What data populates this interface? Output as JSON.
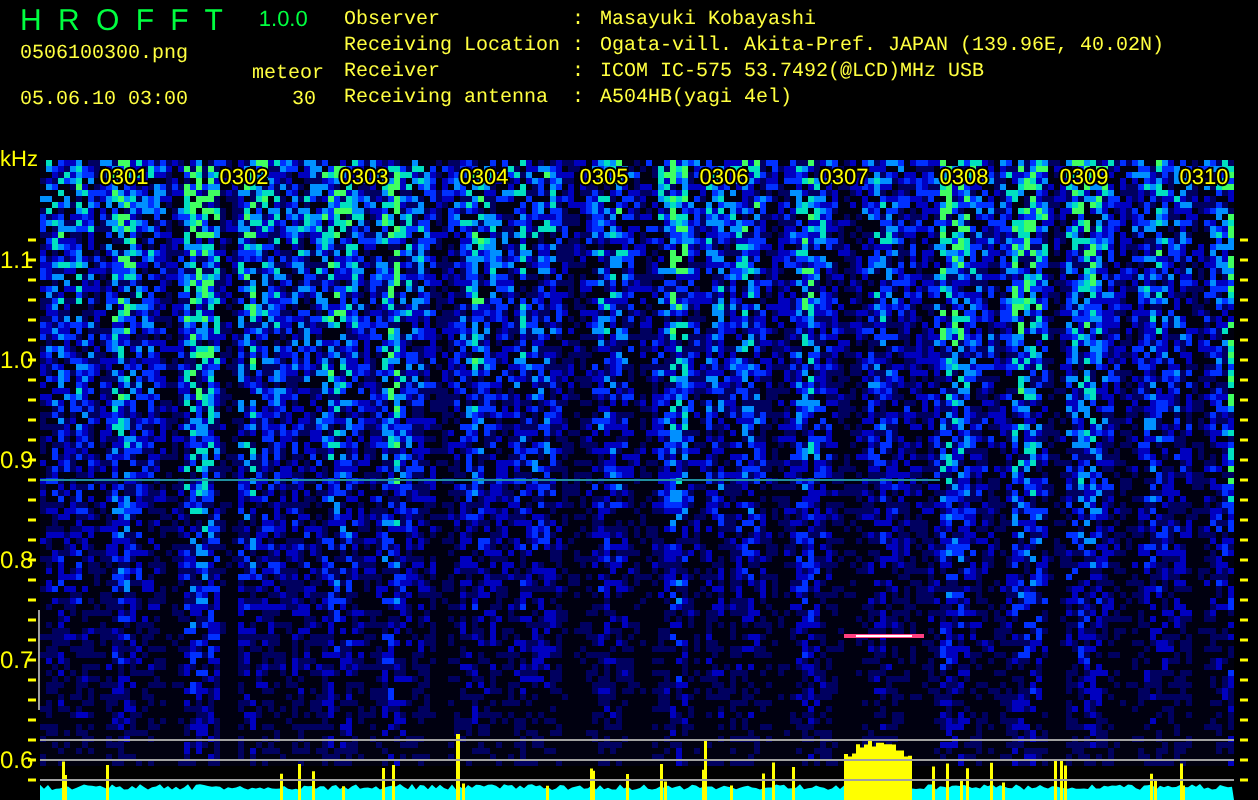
{
  "app": {
    "name": "H R O F F T",
    "version": "1.0.0"
  },
  "file_name": "0506100300.png",
  "timestamp": "05.06.10 03:00",
  "meteor": {
    "label": "meteor",
    "count": "30"
  },
  "info": [
    {
      "label": "Observer",
      "separator": ":",
      "value": "Masayuki Kobayashi"
    },
    {
      "label": "Receiving Location",
      "separator": ":",
      "value": "Ogata-vill. Akita-Pref. JAPAN (139.96E, 40.02N)"
    },
    {
      "label": "Receiver",
      "separator": ":",
      "value": "ICOM IC-575 53.7492(@LCD)MHz USB"
    },
    {
      "label": "Receiving antenna",
      "separator": ":",
      "value": "A504HB(yagi 4el)"
    }
  ],
  "spectrogram": {
    "unit": "kHz",
    "y_labels": [
      "1.1",
      "1.0",
      "0.9",
      "0.8",
      "0.7",
      "0.6"
    ],
    "time_labels": [
      "0301",
      "0302",
      "0303",
      "0304",
      "0305",
      "0306",
      "0307",
      "0308",
      "0309",
      "0310"
    ]
  }
}
